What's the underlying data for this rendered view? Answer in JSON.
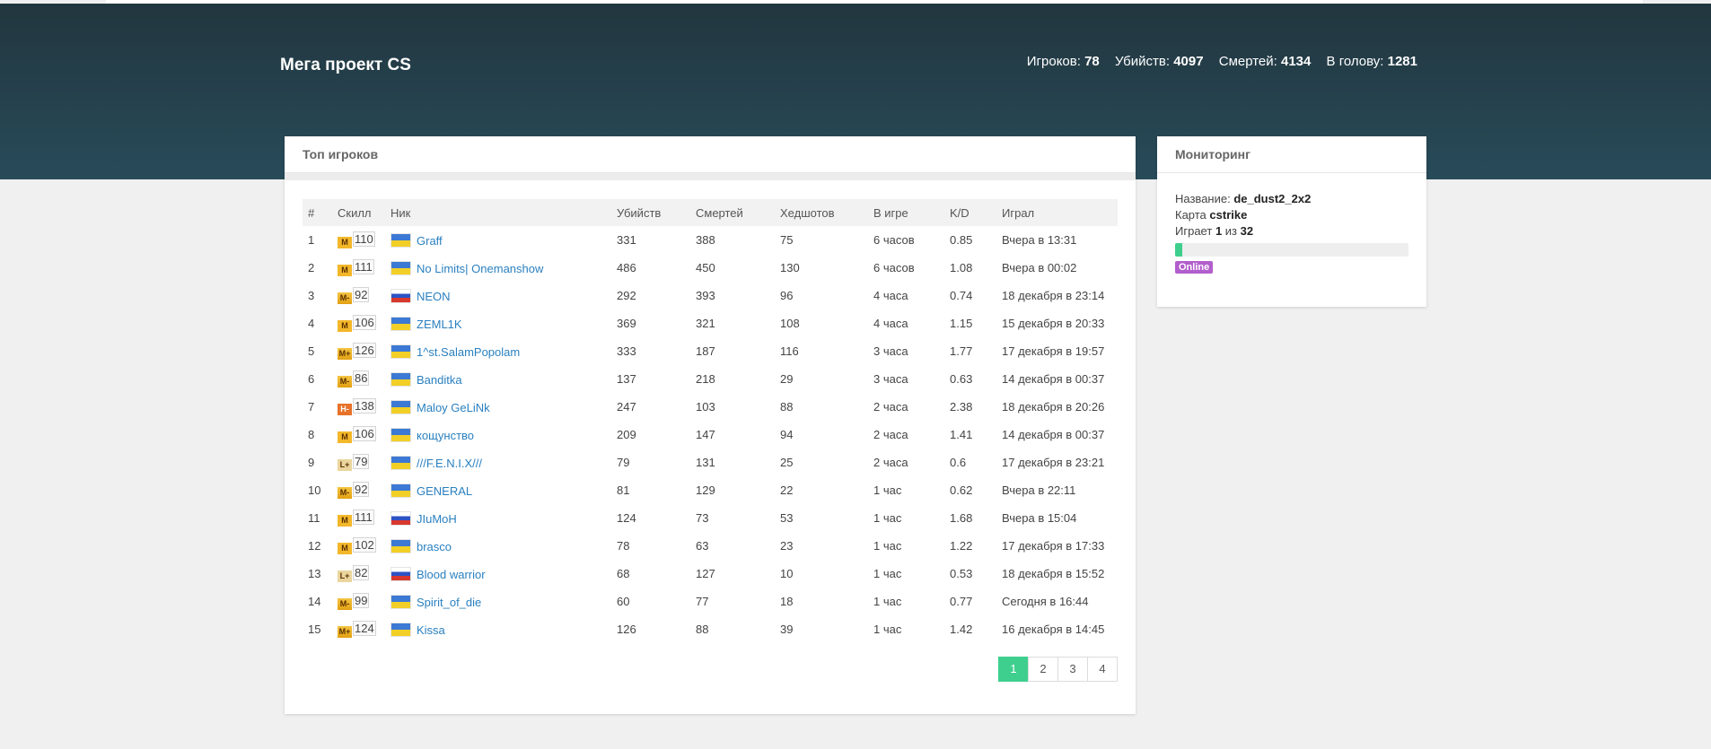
{
  "site": {
    "title": "Мега проект CS"
  },
  "stats": [
    {
      "label": "Игроков:",
      "value": "78"
    },
    {
      "label": "Убийств:",
      "value": "4097"
    },
    {
      "label": "Смертей:",
      "value": "4134"
    },
    {
      "label": "В голову:",
      "value": "1281"
    }
  ],
  "top": {
    "title": "Топ игроков",
    "columns": [
      "#",
      "Скилл",
      "Ник",
      "Убийств",
      "Смертей",
      "Хедшотов",
      "В игре",
      "K/D",
      "Играл"
    ],
    "rows": [
      {
        "n": "1",
        "badge": "M",
        "skill": "110",
        "flag": "ua",
        "nick": "Graff",
        "kills": "331",
        "deaths": "388",
        "hs": "75",
        "time": "6 часов",
        "kd": "0.85",
        "last": "Вчера в 13:31"
      },
      {
        "n": "2",
        "badge": "M",
        "skill": "111",
        "flag": "ua",
        "nick": "No Limits| Onemanshow",
        "kills": "486",
        "deaths": "450",
        "hs": "130",
        "time": "6 часов",
        "kd": "1.08",
        "last": "Вчера в 00:02"
      },
      {
        "n": "3",
        "badge": "M-",
        "skill": "92",
        "flag": "ru",
        "nick": "NEON",
        "kills": "292",
        "deaths": "393",
        "hs": "96",
        "time": "4 часа",
        "kd": "0.74",
        "last": "18 декабря в 23:14"
      },
      {
        "n": "4",
        "badge": "M",
        "skill": "106",
        "flag": "ua",
        "nick": "ZEML1K",
        "kills": "369",
        "deaths": "321",
        "hs": "108",
        "time": "4 часа",
        "kd": "1.15",
        "last": "15 декабря в 20:33"
      },
      {
        "n": "5",
        "badge": "M+",
        "skill": "126",
        "flag": "ua",
        "nick": "1^st.SalamPopolam",
        "kills": "333",
        "deaths": "187",
        "hs": "116",
        "time": "3 часа",
        "kd": "1.77",
        "last": "17 декабря в 19:57"
      },
      {
        "n": "6",
        "badge": "M-",
        "skill": "86",
        "flag": "ua",
        "nick": "Banditka",
        "kills": "137",
        "deaths": "218",
        "hs": "29",
        "time": "3 часа",
        "kd": "0.63",
        "last": "14 декабря в 00:37"
      },
      {
        "n": "7",
        "badge": "H-",
        "skill": "138",
        "flag": "ua",
        "nick": "Maloy GeLiNk",
        "kills": "247",
        "deaths": "103",
        "hs": "88",
        "time": "2 часа",
        "kd": "2.38",
        "last": "18 декабря в 20:26"
      },
      {
        "n": "8",
        "badge": "M",
        "skill": "106",
        "flag": "ua",
        "nick": "кощунство",
        "kills": "209",
        "deaths": "147",
        "hs": "94",
        "time": "2 часа",
        "kd": "1.41",
        "last": "14 декабря в 00:37"
      },
      {
        "n": "9",
        "badge": "L+",
        "skill": "79",
        "flag": "ua",
        "nick": "///F.E.N.I.X///",
        "kills": "79",
        "deaths": "131",
        "hs": "25",
        "time": "2 часа",
        "kd": "0.6",
        "last": "17 декабря в 23:21"
      },
      {
        "n": "10",
        "badge": "M-",
        "skill": "92",
        "flag": "ua",
        "nick": "GENERAL",
        "kills": "81",
        "deaths": "129",
        "hs": "22",
        "time": "1 час",
        "kd": "0.62",
        "last": "Вчера в 22:11"
      },
      {
        "n": "11",
        "badge": "M",
        "skill": "111",
        "flag": "ru",
        "nick": "JIuMoH",
        "kills": "124",
        "deaths": "73",
        "hs": "53",
        "time": "1 час",
        "kd": "1.68",
        "last": "Вчера в 15:04"
      },
      {
        "n": "12",
        "badge": "M",
        "skill": "102",
        "flag": "ua",
        "nick": "brasco",
        "kills": "78",
        "deaths": "63",
        "hs": "23",
        "time": "1 час",
        "kd": "1.22",
        "last": "17 декабря в 17:33"
      },
      {
        "n": "13",
        "badge": "L+",
        "skill": "82",
        "flag": "ru",
        "nick": "Blood warrior",
        "kills": "68",
        "deaths": "127",
        "hs": "10",
        "time": "1 час",
        "kd": "0.53",
        "last": "18 декабря в 15:52"
      },
      {
        "n": "14",
        "badge": "M-",
        "skill": "99",
        "flag": "ua",
        "nick": "Spirit_of_die",
        "kills": "60",
        "deaths": "77",
        "hs": "18",
        "time": "1 час",
        "kd": "0.77",
        "last": "Сегодня в 16:44"
      },
      {
        "n": "15",
        "badge": "M+",
        "skill": "124",
        "flag": "ua",
        "nick": "Kissa",
        "kills": "126",
        "deaths": "88",
        "hs": "39",
        "time": "1 час",
        "kd": "1.42",
        "last": "16 декабря в 14:45"
      }
    ],
    "pages": [
      "1",
      "2",
      "3",
      "4"
    ],
    "active_page": "1"
  },
  "monitor": {
    "title": "Мониторинг",
    "name_label": "Название:",
    "name": "de_dust2_2x2",
    "map_label": "Карта",
    "map": "cstrike",
    "plays_label": "Играет",
    "players": "1",
    "of_label": "из",
    "max_players": "32",
    "fill_fraction": 0.03,
    "status": "Online"
  },
  "colors": {
    "accent": "#3ecf8e",
    "link": "#2a80c0",
    "status": "#b25ecc",
    "header": "#284b59"
  }
}
